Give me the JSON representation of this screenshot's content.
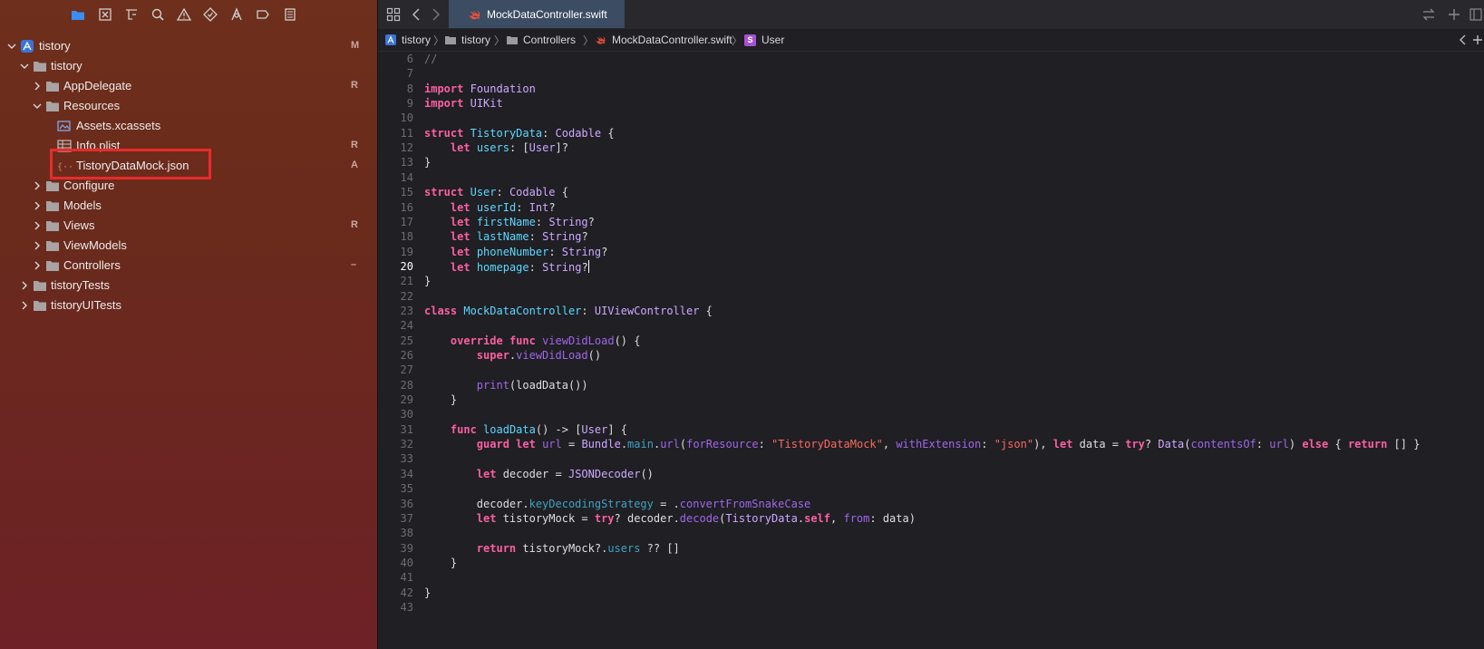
{
  "navigator": {
    "toolbar_icons": [
      "folder-icon",
      "source-control-icon",
      "symbol-icon",
      "search-icon",
      "warning-icon",
      "test-icon",
      "debug-icon",
      "breakpoint-icon",
      "report-icon"
    ],
    "tree": [
      {
        "label": "tistory",
        "status": "M",
        "kind": "project",
        "expanded": true
      },
      {
        "label": "tistory",
        "status": "",
        "kind": "folder",
        "expanded": true
      },
      {
        "label": "AppDelegate",
        "status": "R",
        "kind": "folder",
        "expanded": false
      },
      {
        "label": "Resources",
        "status": "",
        "kind": "folder",
        "expanded": true
      },
      {
        "label": "Assets.xcassets",
        "status": "",
        "kind": "assets"
      },
      {
        "label": "Info.plist",
        "status": "R",
        "kind": "plist"
      },
      {
        "label": "TistoryDataMock.json",
        "status": "A",
        "kind": "json"
      },
      {
        "label": "Configure",
        "status": "",
        "kind": "folder",
        "expanded": false
      },
      {
        "label": "Models",
        "status": "",
        "kind": "folder",
        "expanded": false
      },
      {
        "label": "Views",
        "status": "R",
        "kind": "folder",
        "expanded": false
      },
      {
        "label": "ViewModels",
        "status": "",
        "kind": "folder",
        "expanded": false
      },
      {
        "label": "Controllers",
        "status": "–",
        "kind": "folder",
        "expanded": false
      },
      {
        "label": "tistoryTests",
        "status": "",
        "kind": "folder",
        "expanded": false
      },
      {
        "label": "tistoryUITests",
        "status": "",
        "kind": "folder",
        "expanded": false
      }
    ]
  },
  "editor": {
    "tab_title": "MockDataController.swift",
    "jumpbar": [
      "tistory",
      "tistory",
      "Controllers",
      "MockDataController.swift",
      "User"
    ],
    "symbol_badge": "S",
    "current_line": 20,
    "code_lines": [
      {
        "n": 6,
        "t": "//"
      },
      {
        "n": 7,
        "t": ""
      },
      {
        "n": 8,
        "t": "import Foundation"
      },
      {
        "n": 9,
        "t": "import UIKit"
      },
      {
        "n": 10,
        "t": ""
      },
      {
        "n": 11,
        "t": "struct TistoryData: Codable {"
      },
      {
        "n": 12,
        "t": "    let users: [User]?"
      },
      {
        "n": 13,
        "t": "}"
      },
      {
        "n": 14,
        "t": ""
      },
      {
        "n": 15,
        "t": "struct User: Codable {"
      },
      {
        "n": 16,
        "t": "    let userId: Int?"
      },
      {
        "n": 17,
        "t": "    let firstName: String?"
      },
      {
        "n": 18,
        "t": "    let lastName: String?"
      },
      {
        "n": 19,
        "t": "    let phoneNumber: String?"
      },
      {
        "n": 20,
        "t": "    let homepage: String?"
      },
      {
        "n": 21,
        "t": "}"
      },
      {
        "n": 22,
        "t": ""
      },
      {
        "n": 23,
        "t": "class MockDataController: UIViewController {"
      },
      {
        "n": 24,
        "t": ""
      },
      {
        "n": 25,
        "t": "    override func viewDidLoad() {"
      },
      {
        "n": 26,
        "t": "        super.viewDidLoad()"
      },
      {
        "n": 27,
        "t": ""
      },
      {
        "n": 28,
        "t": "        print(loadData())"
      },
      {
        "n": 29,
        "t": "    }"
      },
      {
        "n": 30,
        "t": ""
      },
      {
        "n": 31,
        "t": "    func loadData() -> [User] {"
      },
      {
        "n": 32,
        "t": "        guard let url = Bundle.main.url(forResource: \"TistoryDataMock\", withExtension: \"json\"), let data = try? Data(contentsOf: url) else { return [] }"
      },
      {
        "n": 33,
        "t": ""
      },
      {
        "n": 34,
        "t": "        let decoder = JSONDecoder()"
      },
      {
        "n": 35,
        "t": ""
      },
      {
        "n": 36,
        "t": "        decoder.keyDecodingStrategy = .convertFromSnakeCase"
      },
      {
        "n": 37,
        "t": "        let tistoryMock = try? decoder.decode(TistoryData.self, from: data)"
      },
      {
        "n": 38,
        "t": ""
      },
      {
        "n": 39,
        "t": "        return tistoryMock?.users ?? []"
      },
      {
        "n": 40,
        "t": "    }"
      },
      {
        "n": 41,
        "t": ""
      },
      {
        "n": 42,
        "t": "}"
      },
      {
        "n": 43,
        "t": ""
      }
    ]
  },
  "colors": {
    "keyword": "#fc5fa3",
    "type": "#d0a8ff",
    "declaration": "#5dd8ff",
    "property": "#41a1c0",
    "function": "#a167e6",
    "string": "#fc6a5d",
    "highlight_box": "#e82b2b",
    "active_tab": "#3b4c63"
  }
}
